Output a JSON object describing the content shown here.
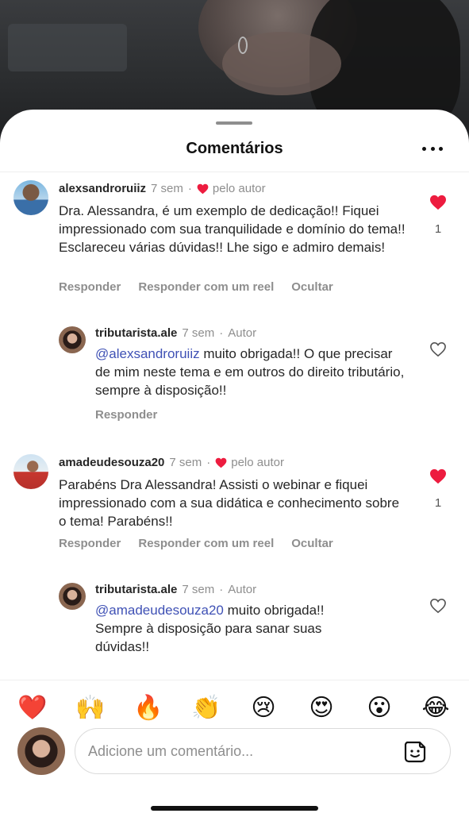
{
  "header": {
    "title": "Comentários"
  },
  "comments": [
    {
      "username": "alexsandroruiiz",
      "time": "7 sem",
      "separator": "·",
      "liked_by_author": "pelo autor",
      "text": "Dra. Alessandra, é um exemplo de dedicação!! Fiquei impressionado com sua tranquilidade e domínio do tema!! Esclareceu várias dúvidas!! Lhe sigo e admiro demais!",
      "likes": "1",
      "actions": [
        "Responder",
        "Responder com um reel",
        "Ocultar"
      ],
      "reply": {
        "username": "tributarista.ale",
        "time": "7 sem",
        "separator": "·",
        "author_tag": "Autor",
        "mention": "@alexsandroruiiz",
        "text": " muito obrigada!! O que precisar de mim neste tema e em outros do direito tributário, sempre à disposição!!",
        "action": "Responder"
      }
    },
    {
      "username": "amadeudesouza20",
      "time": "7 sem",
      "separator": "·",
      "liked_by_author": "pelo autor",
      "text": "Parabéns Dra Alessandra! Assisti o webinar e fiquei impressionado com a sua didática e conhecimento sobre o tema! Parabéns!!",
      "likes": "1",
      "actions": [
        "Responder",
        "Responder com um reel",
        "Ocultar"
      ],
      "reply": {
        "username": "tributarista.ale",
        "time": "7 sem",
        "separator": "·",
        "author_tag": "Autor",
        "mention": "@amadeudesouza20",
        "text": " muito obrigada!! Sempre à disposição para sanar suas dúvidas!!"
      }
    }
  ],
  "reactions": [
    "❤️",
    "🙌",
    "🔥",
    "👏",
    "😢",
    "😍",
    "😮",
    "😂"
  ],
  "composer": {
    "placeholder": "Adicione um comentário..."
  },
  "colors": {
    "like_red": "#ed1c3f",
    "mention_blue": "#3f51b5",
    "muted_gray": "#8e8e8e"
  }
}
